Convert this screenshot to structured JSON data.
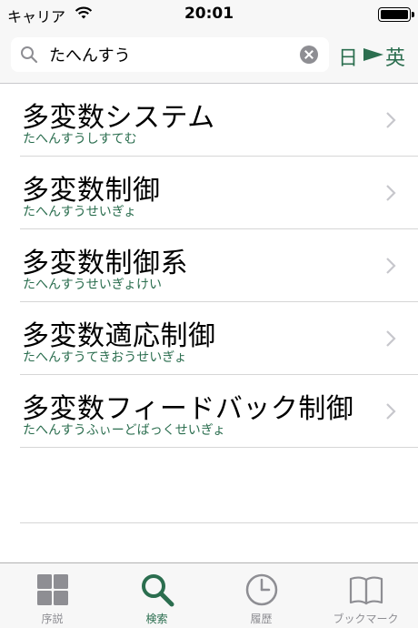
{
  "status_bar": {
    "carrier": "キャリア",
    "time": "20:01"
  },
  "search": {
    "query": "たへんすう",
    "icons": {
      "search": "search-icon",
      "clear": "clear-icon"
    }
  },
  "language_toggle": {
    "from": "日",
    "to": "英",
    "arrow_icon": "play-arrow-icon",
    "color": "#2b6e4f"
  },
  "results": [
    {
      "title": "多変数システム",
      "reading": "たへんすうしすてむ"
    },
    {
      "title": "多変数制御",
      "reading": "たへんすうせいぎょ"
    },
    {
      "title": "多変数制御系",
      "reading": "たへんすうせいぎょけい"
    },
    {
      "title": "多変数適応制御",
      "reading": "たへんすうてきおうせいぎょ"
    },
    {
      "title": "多変数フィードバック制御",
      "reading": "たへんすうふぃーどばっくせいぎょ"
    }
  ],
  "tab_bar": {
    "tabs": [
      {
        "label": "序説",
        "icon": "grid-icon",
        "active": false
      },
      {
        "label": "検索",
        "icon": "search-icon",
        "active": true
      },
      {
        "label": "履歴",
        "icon": "clock-icon",
        "active": false
      },
      {
        "label": "ブックマーク",
        "icon": "book-icon",
        "active": false
      }
    ]
  },
  "colors": {
    "accent": "#2b6e4f",
    "inactive": "#8e8e93"
  }
}
